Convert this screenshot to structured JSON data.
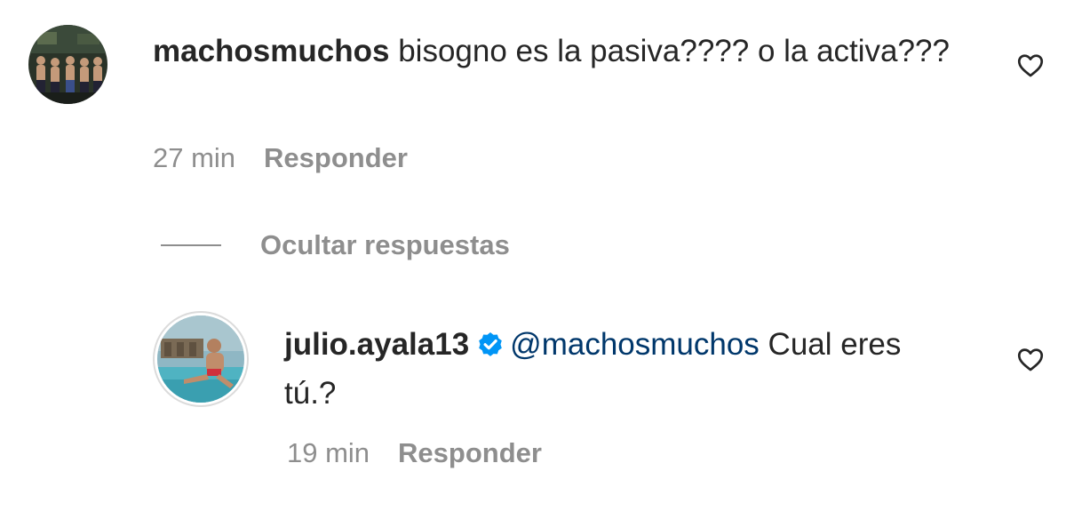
{
  "comment": {
    "username": "machosmuchos",
    "text": "bisogno es la pasiva???? o la activa???",
    "time": "27 min",
    "reply_label": "Responder"
  },
  "replies_toggle": {
    "label": "Ocultar respuestas"
  },
  "reply": {
    "username": "julio.ayala13",
    "verified_icon": "verified-badge-icon",
    "mention": "@machosmuchos",
    "text": "Cual eres tú.?",
    "time": "19 min",
    "reply_label": "Responder"
  },
  "colors": {
    "text": "#262626",
    "secondary": "#8e8e8e",
    "mention": "#00376b",
    "verified": "#0095f6"
  }
}
